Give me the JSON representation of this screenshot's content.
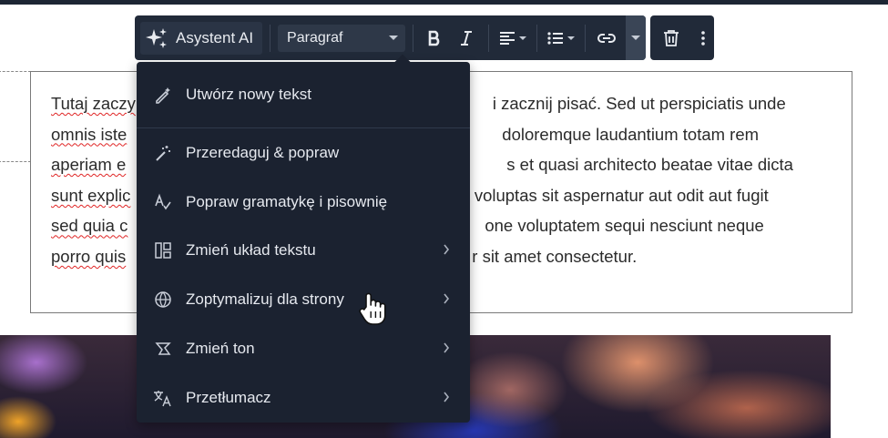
{
  "toolbar": {
    "ai_label": "Asystent AI",
    "block_type": "Paragraf",
    "icons": [
      "sparkles-icon",
      "bold-icon",
      "italic-icon",
      "align-icon",
      "list-icon",
      "link-icon",
      "more-caret-icon",
      "trash-icon",
      "kebab-icon"
    ]
  },
  "editor": {
    "line1_a": "Tutaj zaczy",
    "line1_b": "i zacznij pisać. Sed ut perspiciatis unde",
    "line2_a": "omnis iste",
    "line2_b": "doloremque laudantium totam rem",
    "line3_a": "aperiam e",
    "line3_b": "s et quasi architecto beatae vitae dicta",
    "line4_a": "sunt explic",
    "line4_b": "a voluptas sit aspernatur aut odit aut fugit",
    "line5_a": "sed quia c",
    "line5_b": "one voluptatem sequi nesciunt neque",
    "line6_a": "porro quis",
    "line6_b": "r sit amet consectetur."
  },
  "menu": {
    "items": [
      {
        "label": "Utwórz nowy tekst",
        "icon": "pen-sparkle-icon",
        "submenu": false
      },
      {
        "label": "Przeredaguj & popraw",
        "icon": "magic-wand-icon",
        "submenu": false
      },
      {
        "label": "Popraw gramatykę i pisownię",
        "icon": "spellcheck-icon",
        "submenu": false
      },
      {
        "label": "Zmień układ tekstu",
        "icon": "layout-icon",
        "submenu": true
      },
      {
        "label": "Zoptymalizuj dla strony",
        "icon": "globe-icon",
        "submenu": true
      },
      {
        "label": "Zmień ton",
        "icon": "megaphone-icon",
        "submenu": true
      },
      {
        "label": "Przetłumacz",
        "icon": "translate-icon",
        "submenu": true
      }
    ]
  }
}
